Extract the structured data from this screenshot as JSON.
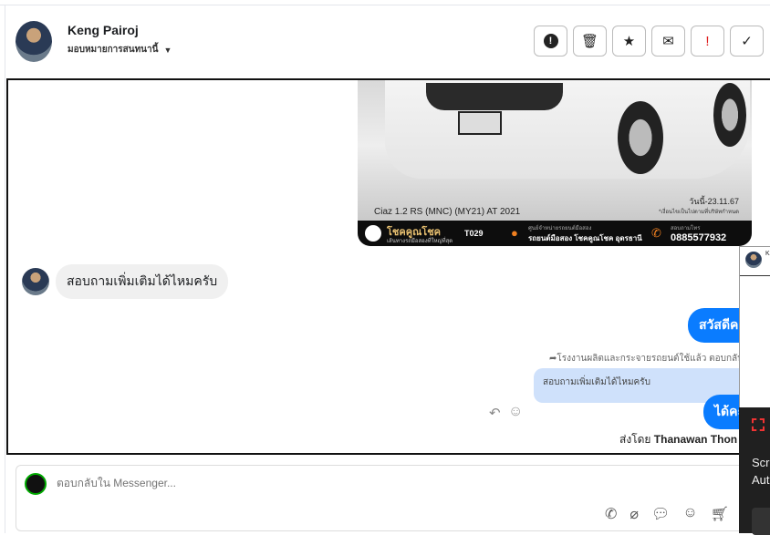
{
  "header": {
    "name": "Keng Pairoj",
    "assign_label": "มอบหมายการสนทนานี้",
    "toolbar": [
      {
        "icon": "alert-circle-icon",
        "label": "!"
      },
      {
        "icon": "trash-icon",
        "label": "🗑"
      },
      {
        "icon": "star-icon",
        "label": "★"
      },
      {
        "icon": "envelope-icon",
        "label": "✉"
      },
      {
        "icon": "exclamation-icon",
        "label": "!"
      },
      {
        "icon": "check-icon",
        "label": "✓"
      }
    ]
  },
  "image_card": {
    "model": "Ciaz 1.2 RS (MNC) (MY21) AT 2021",
    "date": "วันนี้-23.11.67",
    "note": "*เงื่อนไขเป็นไปตามที่บริษัทกำหนด",
    "brand": "โชคคูณโชค",
    "brand_sub": "เส้นทางรถมือสองที่ใหญ่ที่สุด",
    "code": "T029",
    "location_label": "ศูนย์จำหน่ายรถยนต์มือสอง",
    "location": "รถยนต์มือสอง โชคคูณโชค อุดรธานี",
    "phone_label": "สอบถามโทร",
    "phone": "0885577932"
  },
  "messages": {
    "incoming": "สอบถามเพิ่มเติมได้ไหมครับ",
    "outgoing_1": "สวัสดีคะ",
    "reply_context": "โรงงานผลิตและกระจายรถยนต์ใช้แล้ว ตอบกลับ Ke",
    "quoted": "สอบถามเพิ่มเติมได้ไหมครับ",
    "outgoing_2": "ได้คะ",
    "sent_by_prefix": "ส่งโดย",
    "sent_by_name": "Thanawan Thon"
  },
  "composer": {
    "placeholder": "ตอบกลับใน Messenger..."
  },
  "popup": {
    "initial": "K"
  },
  "toast": {
    "line1": "Scr",
    "line2": "Aut"
  },
  "colors": {
    "accent": "#0a7cff",
    "quoted_bg": "#cfe1fb",
    "danger": "#e02020"
  }
}
